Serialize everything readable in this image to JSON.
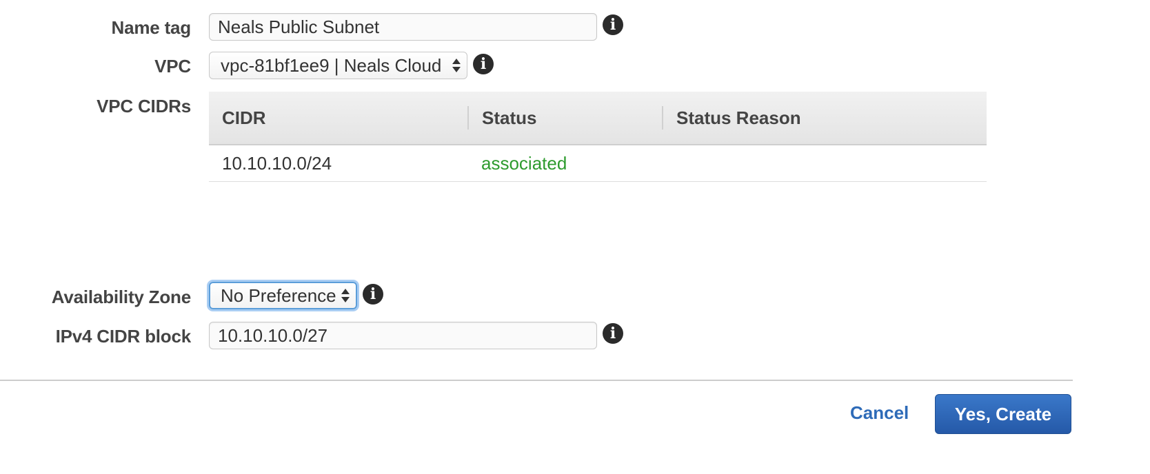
{
  "form": {
    "name_tag": {
      "label": "Name tag",
      "value": "Neals Public Subnet",
      "info_icon": "info-icon"
    },
    "vpc": {
      "label": "VPC",
      "selected": "vpc-81bf1ee9 | Neals Cloud",
      "info_icon": "info-icon"
    },
    "vpc_cidrs": {
      "label": "VPC CIDRs",
      "columns": [
        "CIDR",
        "Status",
        "Status Reason"
      ],
      "rows": [
        {
          "cidr": "10.10.10.0/24",
          "status": "associated",
          "status_reason": ""
        }
      ]
    },
    "availability_zone": {
      "label": "Availability Zone",
      "selected": "No Preference",
      "info_icon": "info-icon"
    },
    "ipv4_cidr_block": {
      "label": "IPv4 CIDR block",
      "value": "10.10.10.0/27",
      "info_icon": "info-icon"
    }
  },
  "actions": {
    "cancel_label": "Cancel",
    "create_label": "Yes, Create"
  },
  "colors": {
    "status_associated": "#2e9b2e",
    "link": "#2e6bb8",
    "primary_button": "#2f68b8",
    "focus_ring": "#5b9dd9"
  }
}
